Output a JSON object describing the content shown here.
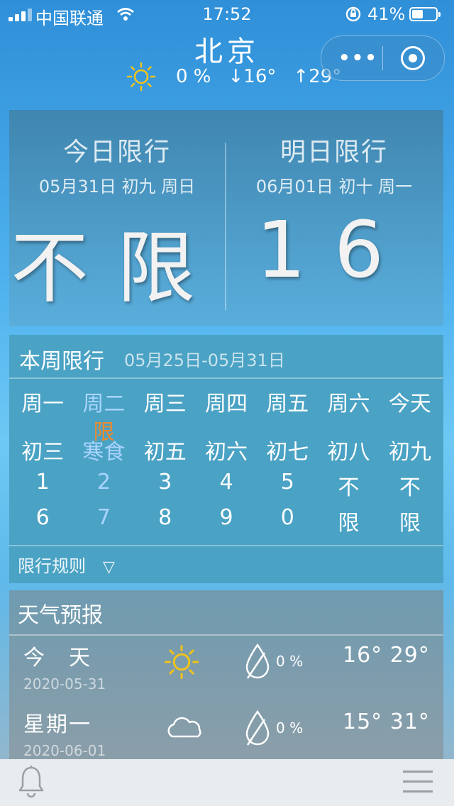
{
  "status_bar": {
    "carrier": "中国联通",
    "time": "17:52",
    "battery": "41%"
  },
  "header": {
    "city": "北京",
    "precip": "0 %",
    "low": "↓16°",
    "high": "↑29°"
  },
  "today": {
    "title": "今日限行",
    "date": "05月31日 初九 周日",
    "value": "不限"
  },
  "tomorrow": {
    "title": "明日限行",
    "date": "06月01日 初十 周一",
    "value": "16"
  },
  "week": {
    "title": "本周限行",
    "range": "05月25日-05月31日",
    "days": [
      {
        "label": "周一",
        "lunar": "初三",
        "first": "1",
        "second": "6"
      },
      {
        "label": "周二",
        "badge": "限",
        "lunar": "寒食",
        "first": "2",
        "second": "7"
      },
      {
        "label": "周三",
        "lunar": "初五",
        "first": "3",
        "second": "8"
      },
      {
        "label": "周四",
        "lunar": "初六",
        "first": "4",
        "second": "9"
      },
      {
        "label": "周五",
        "lunar": "初七",
        "first": "5",
        "second": "0"
      },
      {
        "label": "周六",
        "lunar": "初八",
        "first": "不",
        "second": "限"
      },
      {
        "label": "今天",
        "lunar": "初九",
        "first": "不",
        "second": "限"
      }
    ],
    "rules_label": "限行规则",
    "rules_toggle": "▽"
  },
  "forecast": {
    "title": "天气预报",
    "rows": [
      {
        "day": "今　天",
        "date": "2020-05-31",
        "icon": "sun-icon",
        "pct": "0 %",
        "temps": "16°  29°"
      },
      {
        "day": "星期一",
        "date": "2020-06-01",
        "icon": "cloud-icon",
        "pct": "0 %",
        "temps": "15°  31°"
      }
    ]
  },
  "colors": {
    "highlight_day": "#a9d4ff",
    "badge": "#f08a2a"
  }
}
